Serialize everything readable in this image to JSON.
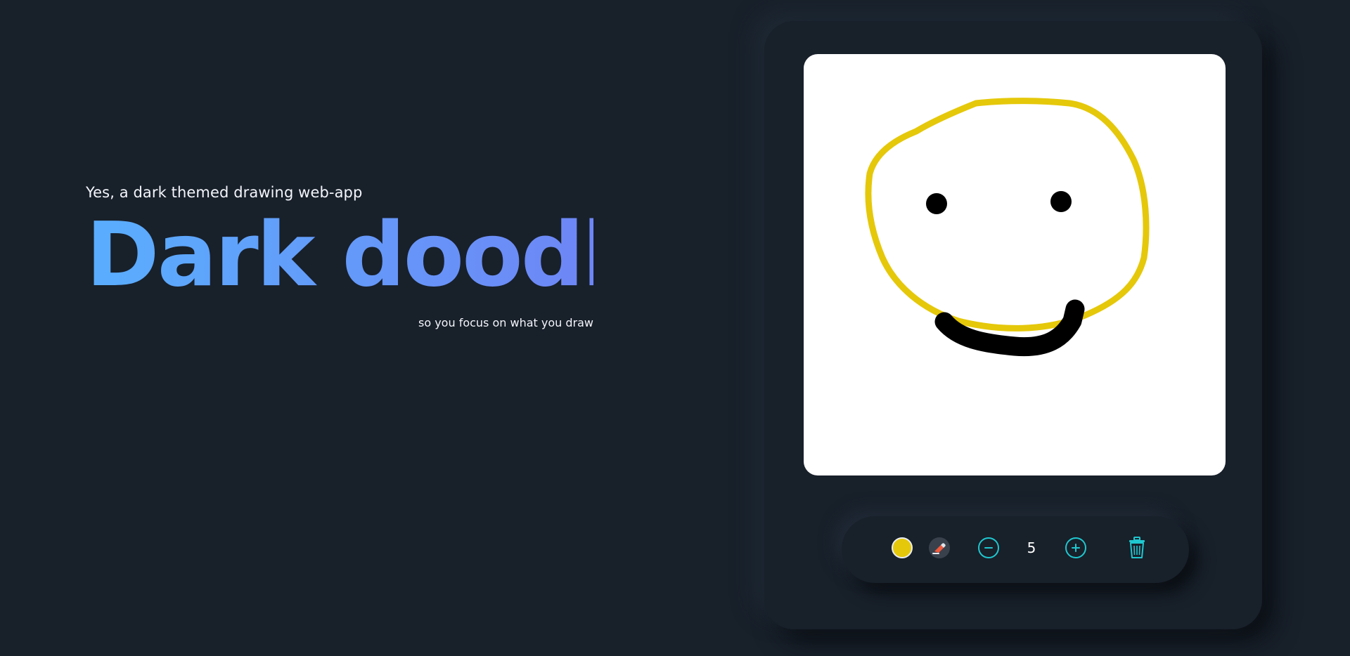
{
  "hero": {
    "tagline": "Yes, a dark themed drawing web-app",
    "title": "Dark doodle",
    "subtitle": "so you focus on what you draw"
  },
  "toolbar": {
    "current_color": "#e5c80a",
    "icons": {
      "color": "color-swatch-icon",
      "eraser": "eraser-icon",
      "decrease": "minus-circle-icon",
      "increase": "plus-circle-icon",
      "clear": "trash-icon"
    },
    "brush_size": "5"
  },
  "colors": {
    "background": "#18202a",
    "title_gradient_start": "#59aefe",
    "title_gradient_end": "#6e86f5",
    "accent": "#1fc7cf",
    "canvas": "#ffffff",
    "stroke_yellow": "#e5c80a",
    "stroke_black": "#000000"
  }
}
